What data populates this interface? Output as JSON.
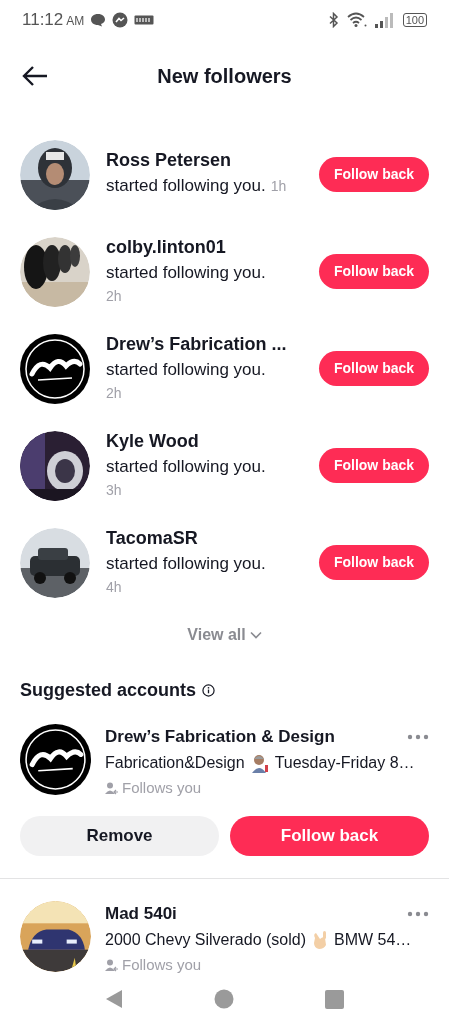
{
  "status_bar": {
    "time": "11:12",
    "ampm": "AM",
    "battery": "100"
  },
  "header": {
    "title": "New followers"
  },
  "followers": [
    {
      "name": "Ross Petersen",
      "message": "started following you.",
      "time": "1h",
      "time_inline": true,
      "button": "Follow back"
    },
    {
      "name": "colby.linton01",
      "message": "started following you.",
      "time": "2h",
      "time_inline": false,
      "button": "Follow back"
    },
    {
      "name": "Drew’s Fabrication ...",
      "message": "started following you.",
      "time": "2h",
      "time_inline": false,
      "avatar": {
        "kind": "logo"
      },
      "button": "Follow back"
    },
    {
      "name": "Kyle Wood",
      "message": "started following you.",
      "time": "3h",
      "time_inline": false,
      "button": "Follow back"
    },
    {
      "name": "TacomaSR",
      "message": "started following you.",
      "time": "4h",
      "time_inline": false,
      "button": "Follow back"
    }
  ],
  "view_all": "View all",
  "suggested": {
    "title": "Suggested accounts",
    "accounts": [
      {
        "name": "Drew’s Fabrication & Design",
        "bio": [
          {
            "kind": "text",
            "text": "Fabrication&Design"
          },
          {
            "kind": "worker"
          },
          {
            "kind": "text",
            "text": "Tuesday-Friday 8…"
          }
        ],
        "follows_you": "Follows you",
        "avatar": {
          "kind": "logo"
        },
        "buttons": [
          "Remove",
          "Follow back"
        ]
      },
      {
        "name": "Mad 540i",
        "bio": [
          {
            "kind": "text",
            "text": "2000 Chevy Silverado (sold)"
          },
          {
            "kind": "hand"
          },
          {
            "kind": "text",
            "text": "BMW 54…"
          }
        ],
        "follows_you": "Follows you"
      }
    ]
  }
}
